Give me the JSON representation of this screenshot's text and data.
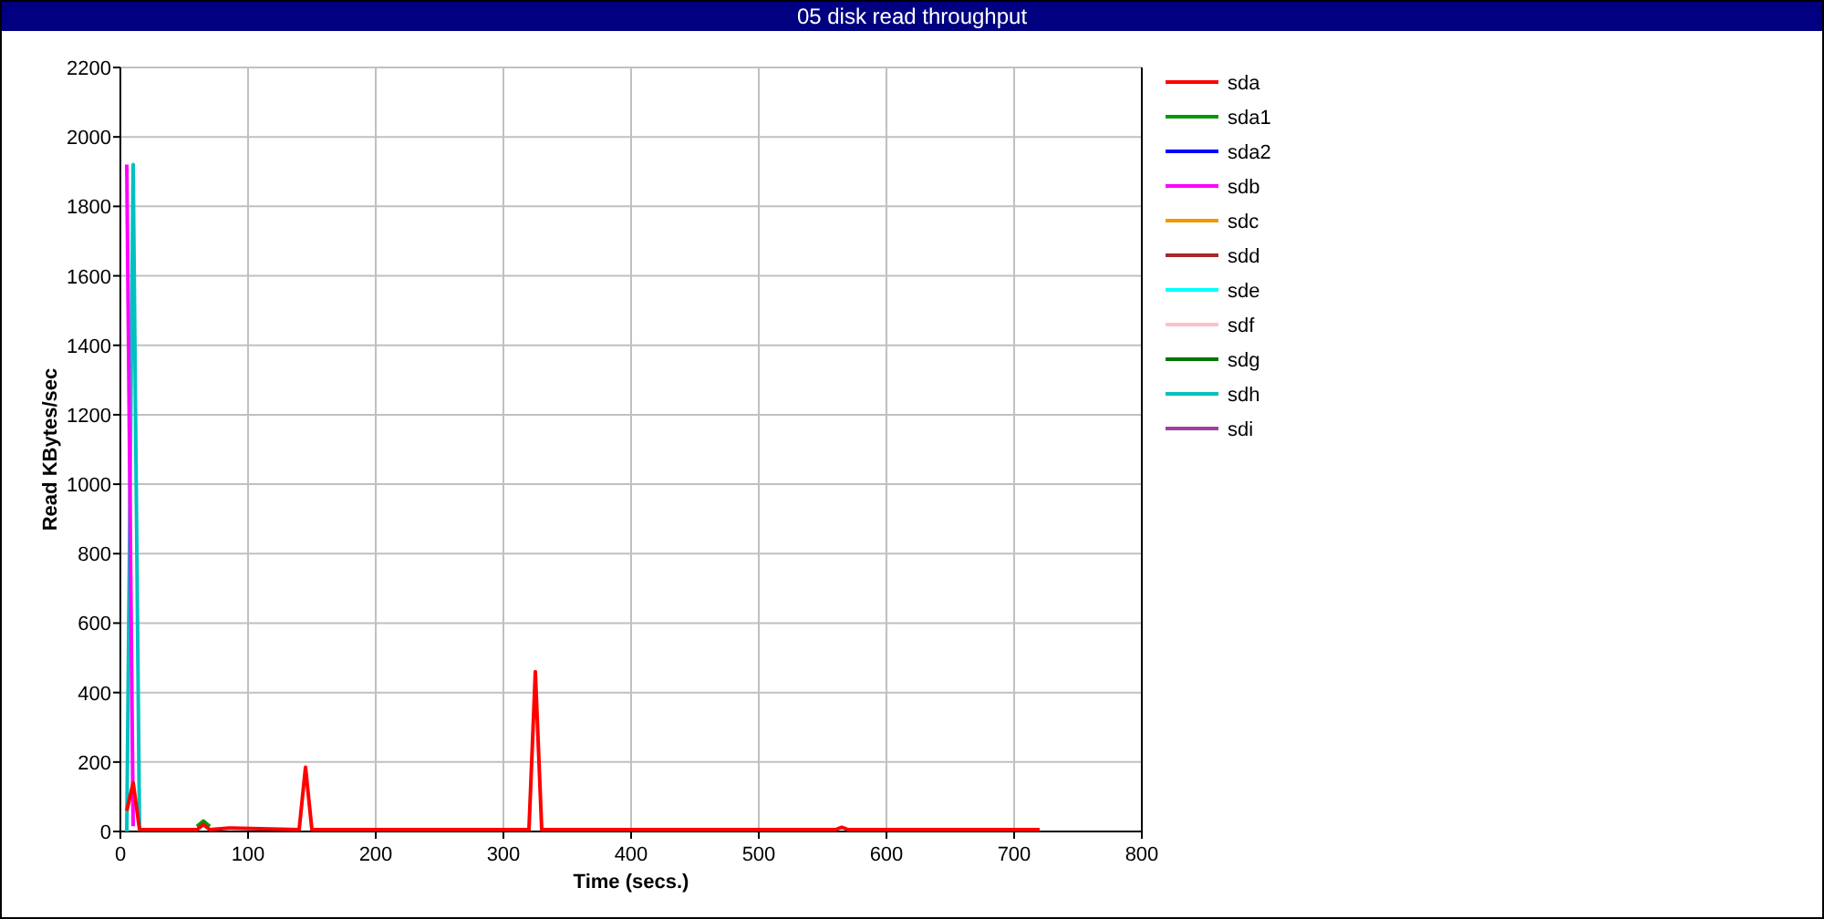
{
  "window": {
    "title": "05 disk read throughput"
  },
  "chart": {
    "chart_data": {
      "type": "line",
      "xlabel": "Time (secs.)",
      "ylabel": "Read KBytes/sec",
      "x": [
        5,
        10,
        15,
        60,
        65,
        70,
        85,
        140,
        145,
        150,
        320,
        325,
        330,
        400,
        560,
        565,
        570,
        720
      ],
      "grid": true,
      "legend": true,
      "xlim": [
        0,
        800
      ],
      "ylim": [
        0,
        2200
      ],
      "xticks": [
        0,
        100,
        200,
        300,
        400,
        500,
        600,
        700,
        800
      ],
      "yticks": [
        0,
        200,
        400,
        600,
        800,
        1000,
        1200,
        1400,
        1600,
        1800,
        2000,
        2200
      ],
      "series": [
        {
          "name": "sda",
          "color": "#ff0000",
          "values": [
            60,
            140,
            5,
            5,
            20,
            5,
            10,
            5,
            185,
            5,
            5,
            460,
            5,
            5,
            5,
            12,
            5,
            5
          ]
        },
        {
          "name": "sda1",
          "color": "#009900",
          "values": [
            null,
            null,
            null,
            14,
            30,
            14,
            null,
            null,
            null,
            null,
            null,
            null,
            null,
            null,
            null,
            null,
            null,
            null
          ]
        },
        {
          "name": "sda2",
          "color": "#0000ff",
          "values": [
            null,
            null,
            null,
            null,
            null,
            null,
            null,
            null,
            null,
            null,
            null,
            null,
            null,
            null,
            null,
            null,
            null,
            null
          ]
        },
        {
          "name": "sdb",
          "color": "#ff00ff",
          "values": [
            1920,
            15,
            null,
            null,
            null,
            null,
            null,
            null,
            null,
            null,
            null,
            null,
            null,
            null,
            null,
            null,
            null,
            null
          ]
        },
        {
          "name": "sdc",
          "color": "#ee9900",
          "values": [
            null,
            null,
            null,
            null,
            null,
            null,
            null,
            null,
            null,
            null,
            null,
            null,
            null,
            null,
            null,
            null,
            null,
            null
          ]
        },
        {
          "name": "sdd",
          "color": "#a52a2a",
          "values": [
            null,
            null,
            null,
            null,
            null,
            null,
            null,
            null,
            null,
            null,
            null,
            null,
            null,
            null,
            null,
            null,
            null,
            null
          ]
        },
        {
          "name": "sde",
          "color": "#00ffff",
          "values": [
            null,
            null,
            null,
            null,
            null,
            null,
            null,
            null,
            null,
            null,
            null,
            null,
            null,
            null,
            null,
            null,
            null,
            null
          ]
        },
        {
          "name": "sdf",
          "color": "#ffc0cb",
          "values": [
            null,
            null,
            null,
            null,
            null,
            null,
            null,
            null,
            null,
            null,
            null,
            null,
            null,
            null,
            null,
            null,
            null,
            null
          ]
        },
        {
          "name": "sdg",
          "color": "#007700",
          "values": [
            null,
            null,
            null,
            null,
            null,
            null,
            null,
            null,
            null,
            null,
            null,
            null,
            null,
            null,
            null,
            null,
            null,
            null
          ]
        },
        {
          "name": "sdh",
          "color": "#00c0c0",
          "values": [
            0,
            1920,
            0,
            null,
            null,
            null,
            null,
            null,
            null,
            null,
            null,
            null,
            null,
            null,
            null,
            null,
            null,
            null
          ]
        },
        {
          "name": "sdi",
          "color": "#a040a0",
          "values": [
            null,
            null,
            null,
            null,
            null,
            null,
            null,
            null,
            null,
            null,
            null,
            null,
            null,
            null,
            null,
            null,
            null,
            null
          ]
        }
      ]
    }
  }
}
